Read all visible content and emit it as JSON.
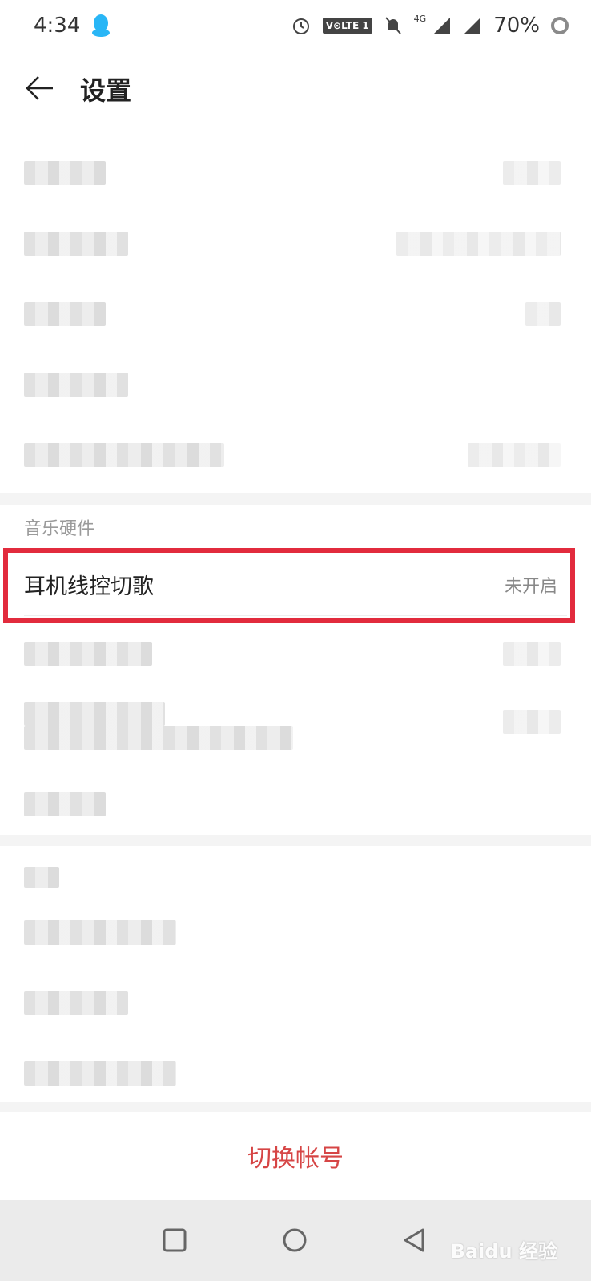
{
  "status_bar": {
    "time": "4:34",
    "volte_label": "V⊙LTE 1",
    "network": "4G",
    "battery": "70%"
  },
  "header": {
    "title": "设置"
  },
  "section": {
    "label": "音乐硬件"
  },
  "feature_row": {
    "label": "耳机线控切歌",
    "value": "未开启"
  },
  "footer": {
    "switch_account": "切换帐号"
  },
  "watermark": {
    "text": "Baidu 经验"
  },
  "colors": {
    "accent": "#d64545",
    "highlight_border": "#e22b3d"
  }
}
